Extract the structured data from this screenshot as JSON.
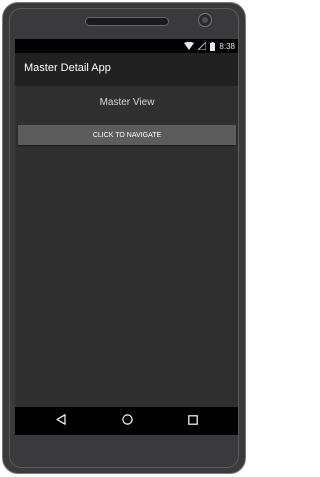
{
  "status_bar": {
    "time": "8:38",
    "icons": [
      "wifi-icon",
      "signal-icon",
      "battery-icon"
    ]
  },
  "action_bar": {
    "title": "Master Detail App"
  },
  "master_view": {
    "title": "Master View",
    "button_label": "CLICK TO NAVIGATE"
  },
  "nav_bar": {
    "icons": [
      "back-icon",
      "home-icon",
      "recents-icon"
    ]
  },
  "colors": {
    "action_bar": "#212121",
    "content_bg": "#303030",
    "button_bg": "#5c5c5c",
    "status_bar": "#000000"
  }
}
